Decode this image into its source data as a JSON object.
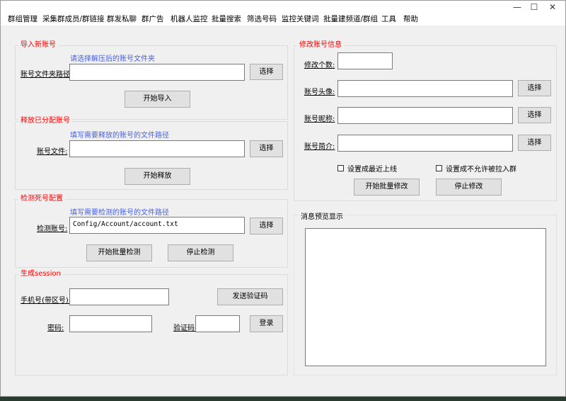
{
  "menu": [
    "群组管理",
    "采集群成员/群链接",
    "群发私聊",
    "群广告",
    "机器人监控",
    "批量搜索",
    "筛选号码",
    "监控关键词",
    "批量建频道/群组",
    "工具",
    "帮助"
  ],
  "window_controls": {
    "minimize": "—",
    "maximize": "☐",
    "close": "✕"
  },
  "import_account": {
    "title": "导入新账号",
    "hint": "请选择解压后的账号文件夹",
    "path_label": "账号文件夹路径:",
    "path_value": "",
    "select_button": "选择",
    "start_button": "开始导入"
  },
  "release_account": {
    "title": "释放已分配账号",
    "hint": "填写需要释放的账号的文件路径",
    "file_label": "账号文件:",
    "file_value": "",
    "select_button": "选择",
    "start_button": "开始释放"
  },
  "check_dead": {
    "title": "检测死号配置",
    "hint": "填写需要检测的账号的文件路径",
    "label": "检测账号:",
    "value": "Config/Account/account.txt",
    "select_button": "选择",
    "start_button": "开始批量检测",
    "stop_button": "停止检测"
  },
  "session": {
    "title": "生成session",
    "phone_label": "手机号(带区号):",
    "phone_value": "",
    "send_code_button": "发送验证码",
    "password_label": "密码:",
    "password_value": "",
    "code_label": "验证码:",
    "code_value": "",
    "login_button": "登录"
  },
  "modify_account": {
    "title": "修改账号信息",
    "count_label": "修改个数:",
    "count_value": "",
    "avatar_label": "账号头像:",
    "avatar_value": "",
    "nickname_label": "账号昵称:",
    "nickname_value": "",
    "bio_label": "账号简介:",
    "bio_value": "",
    "select_button": "选择",
    "online_checkbox": "设置成最近上线",
    "no_invite_checkbox": "设置成不允许被拉入群",
    "start_button": "开始批量修改",
    "stop_button": "停止修改"
  },
  "preview": {
    "title": "消息预览显示"
  }
}
